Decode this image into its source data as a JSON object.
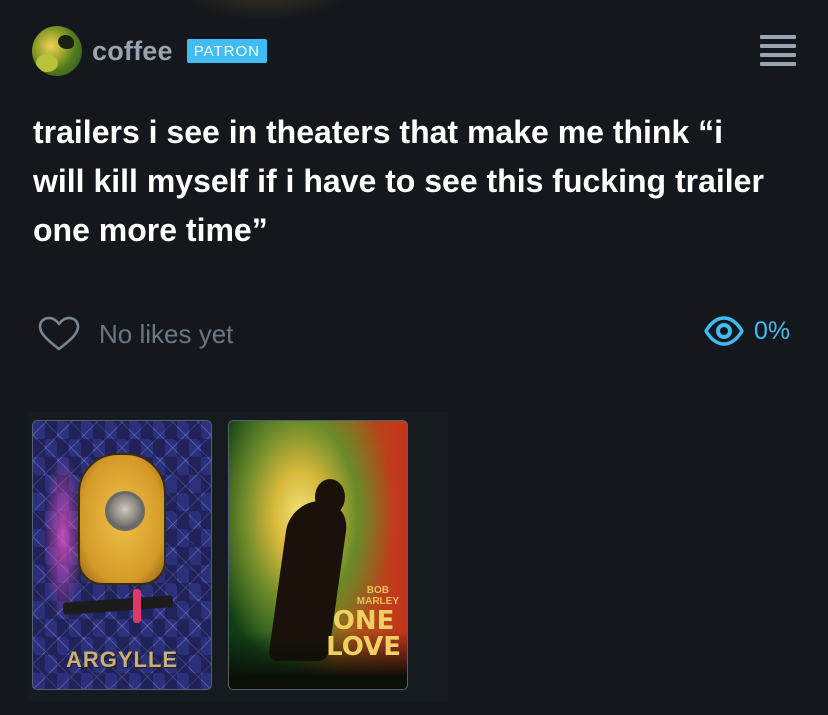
{
  "header": {
    "username": "coffee",
    "badge": "PATRON"
  },
  "post": {
    "text": "trailers i see in theaters that make me think “i will kill myself if i have to see this fucking trailer one more time”"
  },
  "actions": {
    "likes_label": "No likes yet",
    "views_label": "0%"
  },
  "posters": [
    {
      "title": "ARGYLLE"
    },
    {
      "title_small_1": "BOB",
      "title_small_2": "MARLEY",
      "title_big_1": "ONE",
      "title_big_2": "LOVE"
    }
  ],
  "colors": {
    "background": "#14181c",
    "accent": "#40bcf4",
    "muted": "#6b7783",
    "text": "#ffffff"
  },
  "icons": {
    "like": "heart-outline-icon",
    "views": "eye-icon",
    "menu": "hamburger-menu-icon"
  }
}
